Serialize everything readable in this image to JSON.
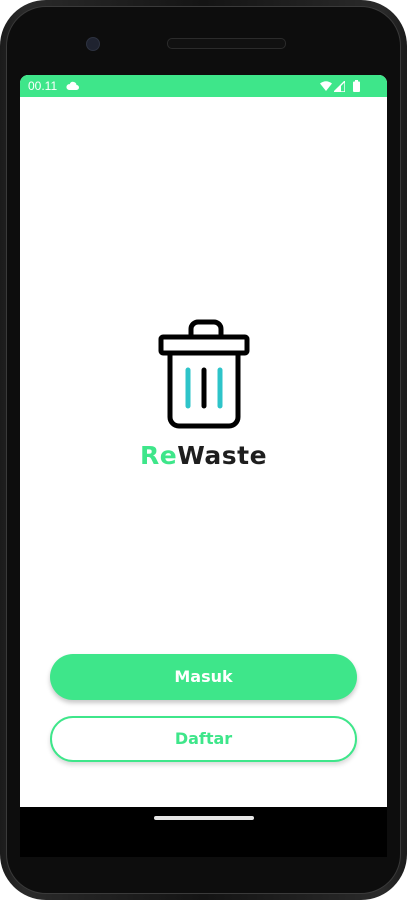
{
  "status_bar": {
    "time": "00.11",
    "icons": [
      "cloud-icon",
      "wifi-icon",
      "signal-icon",
      "battery-icon"
    ],
    "background": "#3ee68a"
  },
  "brand": {
    "accent_part": "Re",
    "rest_part": "Waste",
    "accent_color": "#3ee68a",
    "text_color": "#1e1e1e",
    "logo_icon": "trash-bin-icon",
    "logo_stripe_color": "#2ec4c9"
  },
  "actions": {
    "login_label": "Masuk",
    "register_label": "Daftar"
  },
  "colors": {
    "primary": "#3ee68a",
    "screen_background": "#ffffff"
  }
}
